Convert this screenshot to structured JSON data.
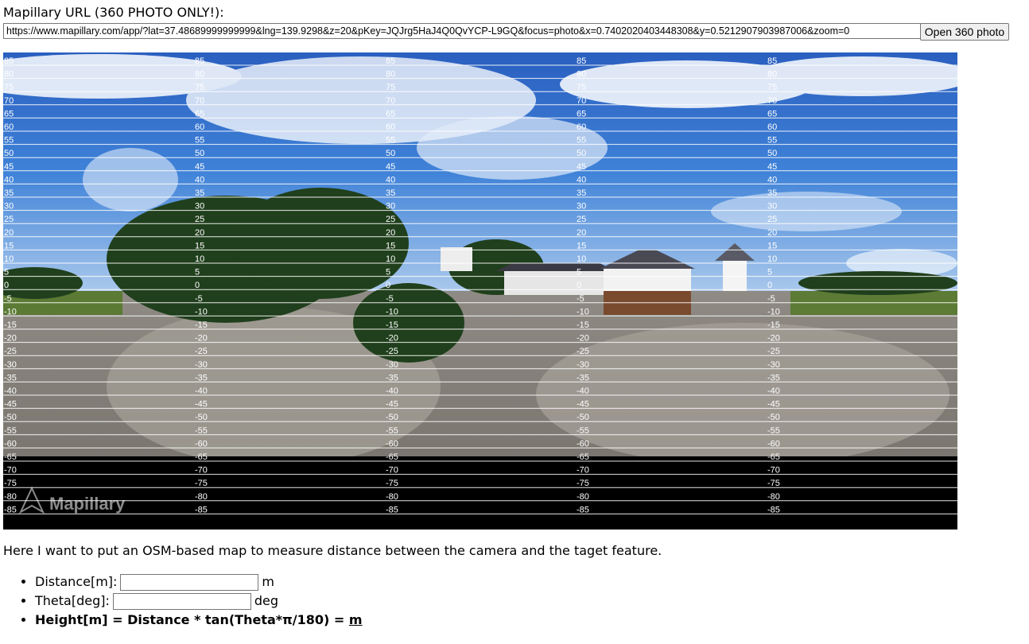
{
  "header": {
    "url_label": "Mapillary URL (360 PHOTO ONLY!):",
    "url_value": "https://www.mapillary.com/app/?lat=37.48689999999999&lng=139.9298&z=20&pKey=JQJrg5HaJ4Q0QvYCP-L9GQ&focus=photo&x=0.7402020403448308&y=0.5212907903987006&zoom=0",
    "open_button_label": "Open 360 photo"
  },
  "panorama": {
    "watermark": "Mapillary",
    "angle_labels": [
      "85",
      "80",
      "75",
      "70",
      "65",
      "60",
      "55",
      "50",
      "45",
      "40",
      "35",
      "30",
      "25",
      "20",
      "15",
      "10",
      "5",
      "0",
      "-5",
      "-10",
      "-15",
      "-20",
      "-25",
      "-30",
      "-35",
      "-40",
      "-45",
      "-50",
      "-55",
      "-60",
      "-65",
      "-70",
      "-75",
      "-80",
      "-85"
    ],
    "colors": {
      "sky_top": "#2a63c8",
      "sky_mid": "#4d8be0",
      "horizon": "#cfe0f3",
      "ground": "#9a958c",
      "tree": "#1f3d1a",
      "bottom": "#000000"
    }
  },
  "description": "Here I want to put an OSM-based map to measure distance between the camera and the taget feature.",
  "fields": {
    "distance_label": "Distance[m]:",
    "distance_value": "",
    "distance_unit": "m",
    "theta_label": "Theta[deg]:",
    "theta_value": "",
    "theta_unit": "deg",
    "formula_text": "Height[m] = Distance * tan(Theta*π/180) = ",
    "formula_result_unit": "m"
  }
}
